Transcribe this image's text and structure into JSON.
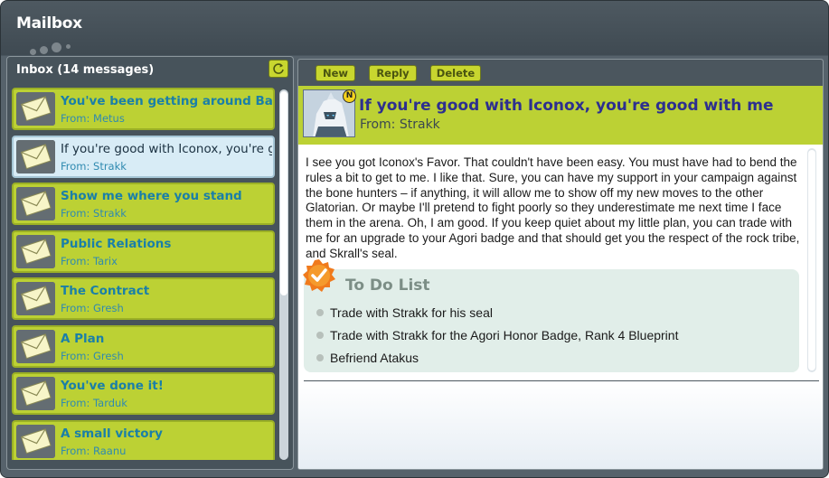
{
  "window": {
    "title": "Mailbox"
  },
  "inbox": {
    "title": "Inbox (14 messages)",
    "refresh_icon": "refresh-icon",
    "messages": [
      {
        "subject": "You've been getting around Bara M",
        "from": "From: Metus",
        "selected": false
      },
      {
        "subject": "If you're good with Iconox, you're g",
        "from": "From: Strakk",
        "selected": true
      },
      {
        "subject": "Show me where you stand",
        "from": "From: Strakk",
        "selected": false
      },
      {
        "subject": "Public Relations",
        "from": "From: Tarix",
        "selected": false
      },
      {
        "subject": "The Contract",
        "from": "From: Gresh",
        "selected": false
      },
      {
        "subject": "A Plan",
        "from": "From: Gresh",
        "selected": false
      },
      {
        "subject": "You've done it!",
        "from": "From: Tarduk",
        "selected": false
      },
      {
        "subject": "A small victory",
        "from": "From: Raanu",
        "selected": false
      }
    ]
  },
  "toolbar": {
    "new_label": "New",
    "reply_label": "Reply",
    "delete_label": "Delete"
  },
  "message": {
    "title": "If you're good with Iconox, you're good with me",
    "from": "From: Strakk",
    "badge": "N",
    "body": "I see you got Iconox's Favor. That couldn't have been easy. You must have had to bend the rules a bit to get to me. I like that. Sure, you can have my support in your campaign against the bone hunters – if anything, it will allow me to show off my new moves to the other Glatorian. Or maybe I'll pretend to fight poorly so they underestimate me next time I face them in the arena. Oh, I am good. If you keep quiet about my little plan, you can trade with me for an upgrade to your Agori badge and that should get you the respect of the rock tribe, and Skrall's seal.",
    "todo": {
      "title": "To Do List",
      "items": [
        "Trade with Strakk for his seal",
        "Trade with Strakk for the Agori Honor Badge, Rank 4 Blueprint",
        "Befriend Atakus"
      ]
    }
  },
  "colors": {
    "accent": "#bcd134",
    "frame": "#4b565e",
    "link": "#1a7fa8",
    "title": "#2d2f8f"
  }
}
